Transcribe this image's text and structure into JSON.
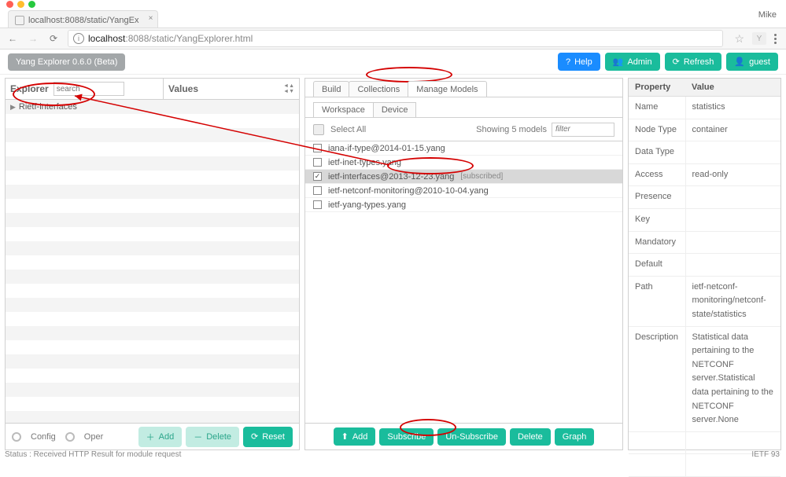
{
  "browser": {
    "tab_title": "localhost:8088/static/YangEx",
    "user": "Mike",
    "url_host": "localhost",
    "url_port": ":8088",
    "url_path": "/static/YangExplorer.html"
  },
  "appbar": {
    "title": "Yang Explorer 0.6.0 (Beta)",
    "help": "Help",
    "admin": "Admin",
    "refresh": "Refresh",
    "guest": "guest"
  },
  "explorer": {
    "title": "Explorer",
    "search_placeholder": "search",
    "values_title": "Values",
    "tree_item": "Rietf-interfaces",
    "radio_config": "Config",
    "radio_oper": "Oper",
    "add": "Add",
    "delete": "Delete",
    "reset": "Reset"
  },
  "center": {
    "tabs_outer": [
      "Build",
      "Collections",
      "Manage Models"
    ],
    "active_outer": 2,
    "tabs_inner": [
      "Workspace",
      "Device"
    ],
    "active_inner": 0,
    "select_all": "Select All",
    "showing": "Showing 5 models",
    "filter_placeholder": "filter",
    "models": [
      {
        "name": "iana-if-type@2014-01-15.yang",
        "checked": false,
        "subscribed": false
      },
      {
        "name": "ietf-inet-types.yang",
        "checked": false,
        "subscribed": false
      },
      {
        "name": "ietf-interfaces@2013-12-23.yang",
        "checked": true,
        "subscribed": true
      },
      {
        "name": "ietf-netconf-monitoring@2010-10-04.yang",
        "checked": false,
        "subscribed": false
      },
      {
        "name": "ietf-yang-types.yang",
        "checked": false,
        "subscribed": false
      }
    ],
    "subscribed_tag": "[subscribed]",
    "buttons": {
      "add": "Add",
      "subscribe": "Subscribe",
      "unsubscribe": "Un-Subscribe",
      "delete": "Delete",
      "graph": "Graph"
    }
  },
  "props": {
    "header_property": "Property",
    "header_value": "Value",
    "rows": [
      {
        "k": "Name",
        "v": "statistics"
      },
      {
        "k": "Node Type",
        "v": "container"
      },
      {
        "k": "Data Type",
        "v": ""
      },
      {
        "k": "Access",
        "v": "read-only"
      },
      {
        "k": "Presence",
        "v": ""
      },
      {
        "k": "Key",
        "v": ""
      },
      {
        "k": "Mandatory",
        "v": ""
      },
      {
        "k": "Default",
        "v": ""
      },
      {
        "k": "Path",
        "v": "ietf-netconf-monitoring/netconf-state/statistics"
      },
      {
        "k": "Description",
        "v": "Statistical data pertaining to the NETCONF server.Statistical data pertaining to the NETCONF server.None"
      }
    ]
  },
  "status": "Status : Received HTTP Result for module request",
  "footer_right": "IETF 93"
}
